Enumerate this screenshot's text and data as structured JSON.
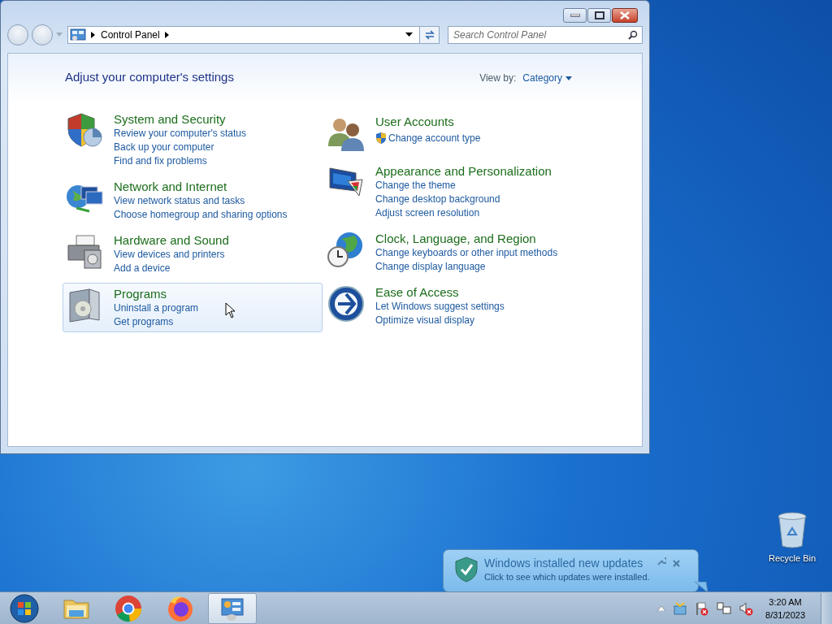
{
  "window": {
    "breadcrumb": "Control Panel",
    "search": {
      "placeholder": "Search Control Panel"
    },
    "heading": "Adjust your computer's settings",
    "view_by_label": "View by:",
    "view_by_value": "Category"
  },
  "columns": [
    [
      {
        "title": "System and Security",
        "hovered": false,
        "links": [
          {
            "text": "Review your computer's status",
            "shield": false
          },
          {
            "text": "Back up your computer",
            "shield": false
          },
          {
            "text": "Find and fix problems",
            "shield": false
          }
        ]
      },
      {
        "title": "Network and Internet",
        "hovered": false,
        "links": [
          {
            "text": "View network status and tasks",
            "shield": false
          },
          {
            "text": "Choose homegroup and sharing options",
            "shield": false
          }
        ]
      },
      {
        "title": "Hardware and Sound",
        "hovered": false,
        "links": [
          {
            "text": "View devices and printers",
            "shield": false
          },
          {
            "text": "Add a device",
            "shield": false
          }
        ]
      },
      {
        "title": "Programs",
        "hovered": true,
        "links": [
          {
            "text": "Uninstall a program",
            "shield": false
          },
          {
            "text": "Get programs",
            "shield": false
          }
        ]
      }
    ],
    [
      {
        "title": "User Accounts",
        "hovered": false,
        "links": [
          {
            "text": "Change account type",
            "shield": true
          }
        ]
      },
      {
        "title": "Appearance and Personalization",
        "hovered": false,
        "links": [
          {
            "text": "Change the theme",
            "shield": false
          },
          {
            "text": "Change desktop background",
            "shield": false
          },
          {
            "text": "Adjust screen resolution",
            "shield": false
          }
        ]
      },
      {
        "title": "Clock, Language, and Region",
        "hovered": false,
        "links": [
          {
            "text": "Change keyboards or other input methods",
            "shield": false
          },
          {
            "text": "Change display language",
            "shield": false
          }
        ]
      },
      {
        "title": "Ease of Access",
        "hovered": false,
        "links": [
          {
            "text": "Let Windows suggest settings",
            "shield": false
          },
          {
            "text": "Optimize visual display",
            "shield": false
          }
        ]
      }
    ]
  ],
  "desktop": {
    "recycle_bin": "Recycle Bin"
  },
  "notification": {
    "title": "Windows installed new updates",
    "message": "Click to see which updates were installed."
  },
  "taskbar": {
    "items": [
      {
        "kind": "folder",
        "selected": false
      },
      {
        "kind": "chrome",
        "selected": false
      },
      {
        "kind": "firefox",
        "selected": false
      },
      {
        "kind": "control-panel",
        "selected": true
      }
    ],
    "time": "3:20 AM",
    "date": "8/31/2023"
  }
}
